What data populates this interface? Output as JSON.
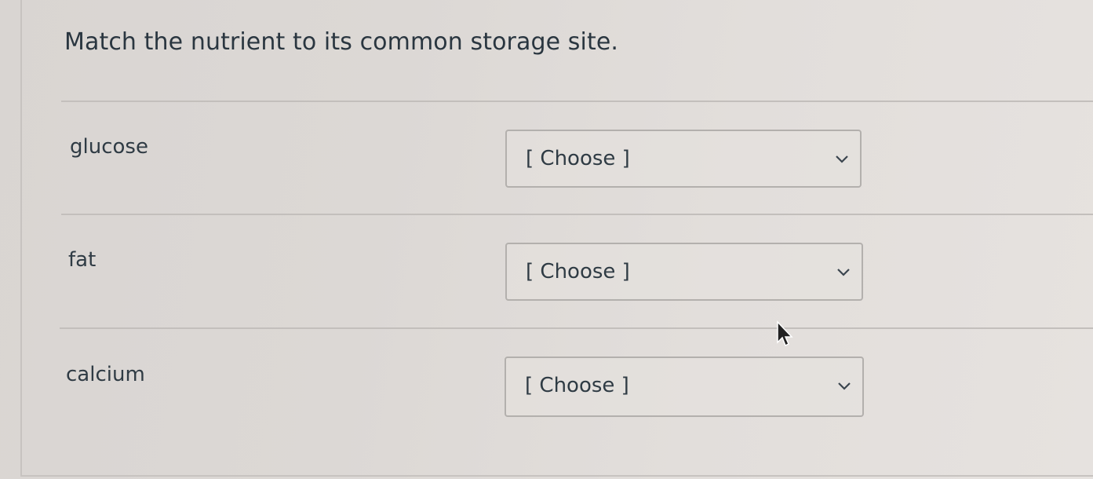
{
  "question": {
    "text": "Match the nutrient to its common storage site."
  },
  "rows": [
    {
      "label": "glucose",
      "select_value": "[ Choose ]"
    },
    {
      "label": "fat",
      "select_value": "[ Choose ]"
    },
    {
      "label": "calcium",
      "select_value": "[ Choose ]"
    }
  ],
  "icons": {
    "dropdown": "chevron-down-icon",
    "pointer": "mouse-cursor-icon"
  },
  "colors": {
    "background": "#dcd8d5",
    "text": "#2d3b45",
    "border": "#b3b0ad"
  }
}
